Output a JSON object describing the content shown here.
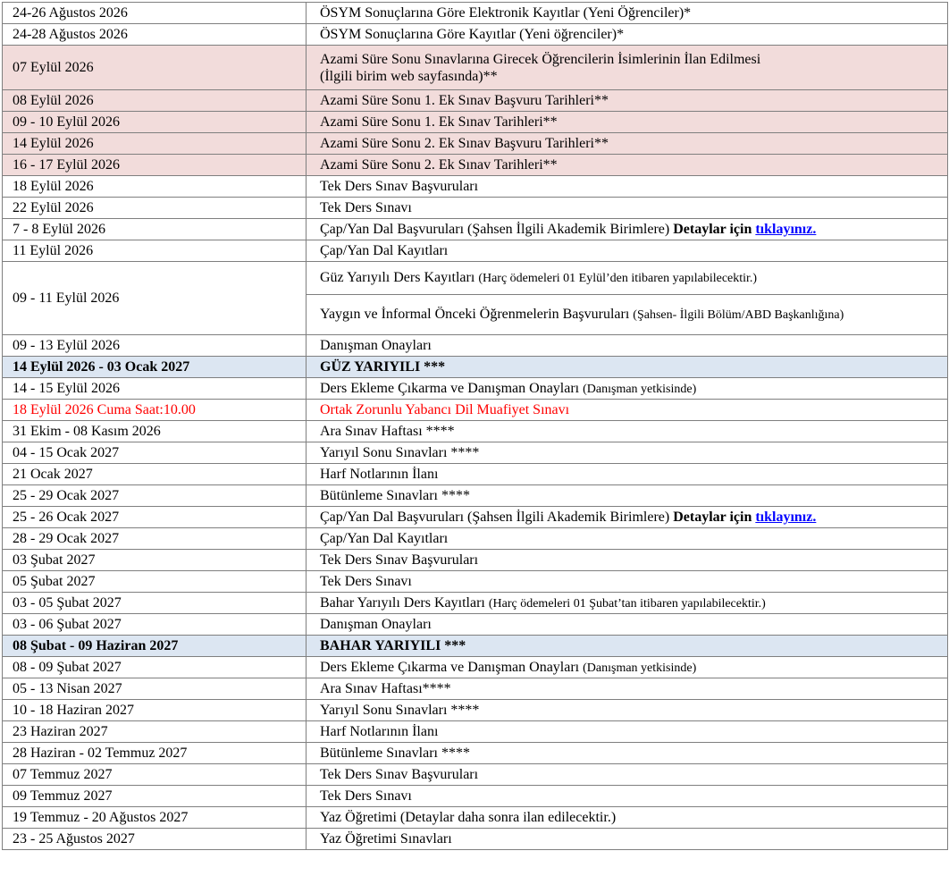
{
  "rows": [
    {
      "date": "24-26 Ağustos 2026",
      "desc": "ÖSYM Sonuçlarına Göre Elektronik Kayıtlar (Yeni Öğrenciler)*"
    },
    {
      "date": "24-28 Ağustos 2026",
      "desc": "ÖSYM Sonuçlarına Göre Kayıtlar (Yeni öğrenciler)*"
    },
    {
      "date": "07 Eylül 2026",
      "desc_line1": "Azami Süre Sonu Sınavlarına Girecek Öğrencilerin İsimlerinin İlan Edilmesi",
      "desc_line2": "(İlgili birim web sayfasında)**"
    },
    {
      "date": "08 Eylül 2026",
      "desc": "Azami Süre Sonu 1. Ek Sınav Başvuru Tarihleri**"
    },
    {
      "date": "09 - 10 Eylül 2026",
      "desc": "Azami Süre Sonu 1. Ek Sınav Tarihleri**"
    },
    {
      "date": "14 Eylül 2026",
      "desc": "Azami Süre Sonu 2. Ek Sınav Başvuru Tarihleri**"
    },
    {
      "date": "16 - 17 Eylül 2026",
      "desc": "Azami Süre Sonu 2. Ek Sınav Tarihleri**"
    },
    {
      "date": "18 Eylül 2026",
      "desc": "Tek Ders Sınav Başvuruları"
    },
    {
      "date": "22 Eylül 2026",
      "desc": "Tek Ders Sınavı"
    },
    {
      "date": "7 - 8 Eylül 2026",
      "desc": "Çap/Yan Dal Başvuruları (Şahsen İlgili Akademik Birimlere)",
      "bold": "Detaylar için",
      "link": "tıklayınız."
    },
    {
      "date": "11 Eylül 2026",
      "desc": "Çap/Yan Dal Kayıtları"
    },
    {
      "date": "09 - 11 Eylül 2026",
      "desc_a": "Güz Yarıyılı Ders Kayıtları",
      "desc_a_small": "(Harç ödemeleri  01 Eylül’den itibaren yapılabilecektir.)",
      "desc_b": "Yaygın ve İnformal Önceki Öğrenmelerin Başvuruları",
      "desc_b_small": "(Şahsen- İlgili Bölüm/ABD Başkanlığına)"
    },
    {
      "date": "09 - 13 Eylül 2026",
      "desc": "Danışman Onayları"
    },
    {
      "date": "14 Eylül  2026 - 03 Ocak 2027",
      "desc": "GÜZ YARIYILI  ***"
    },
    {
      "date": "14  - 15 Eylül 2026",
      "desc": "Ders Ekleme Çıkarma ve Danışman Onayları",
      "small": "(Danışman yetkisinde)"
    },
    {
      "date": "18 Eylül 2026 Cuma Saat:10.00",
      "desc": "Ortak Zorunlu Yabancı Dil Muafiyet Sınavı"
    },
    {
      "date": "31 Ekim - 08 Kasım 2026",
      "desc": "Ara Sınav Haftası ****"
    },
    {
      "date": "04  - 15 Ocak 2027",
      "desc": "Yarıyıl Sonu Sınavları ****"
    },
    {
      "date": "21 Ocak 2027",
      "desc": "Harf Notlarının İlanı"
    },
    {
      "date": "25 - 29 Ocak 2027",
      "desc": "Bütünleme Sınavları ****"
    },
    {
      "date": "25 - 26 Ocak 2027",
      "desc": "Çap/Yan Dal Başvuruları (Şahsen İlgili Akademik Birimlere)",
      "bold": "Detaylar için",
      "link": "tıklayınız."
    },
    {
      "date": "28 - 29 Ocak 2027",
      "desc": "Çap/Yan Dal Kayıtları"
    },
    {
      "date": "03 Şubat 2027",
      "desc": "Tek Ders Sınav Başvuruları"
    },
    {
      "date": "05 Şubat 2027",
      "desc": "Tek Ders Sınavı"
    },
    {
      "date": "03 - 05 Şubat 2027",
      "desc": "Bahar Yarıyılı Ders Kayıtları",
      "small": "(Harç ödemeleri 01 Şubat’tan itibaren yapılabilecektir.)"
    },
    {
      "date": "03 - 06 Şubat 2027",
      "desc": "Danışman Onayları"
    },
    {
      "date": "08 Şubat - 09 Haziran 2027",
      "desc": "BAHAR YARIYILI ***"
    },
    {
      "date": "08 - 09 Şubat 2027",
      "desc": "Ders Ekleme Çıkarma ve Danışman Onayları",
      "small": "(Danışman yetkisinde)"
    },
    {
      "date": "05 - 13 Nisan 2027",
      "desc": "Ara Sınav Haftası****"
    },
    {
      "date": "10 - 18 Haziran 2027",
      "desc": "Yarıyıl Sonu Sınavları ****"
    },
    {
      "date": "23 Haziran 2027",
      "desc": "Harf Notlarının İlanı"
    },
    {
      "date": "28 Haziran - 02 Temmuz 2027",
      "desc": "Bütünleme Sınavları ****"
    },
    {
      "date": "07 Temmuz 2027",
      "desc": "Tek Ders Sınav Başvuruları"
    },
    {
      "date": "09 Temmuz 2027",
      "desc": "Tek Ders Sınavı"
    },
    {
      "date": "19 Temmuz - 20 Ağustos 2027",
      "desc": "Yaz Öğretimi (Detaylar daha sonra ilan edilecektir.)"
    },
    {
      "date": "23 - 25 Ağustos 2027",
      "desc": "Yaz Öğretimi Sınavları"
    }
  ]
}
